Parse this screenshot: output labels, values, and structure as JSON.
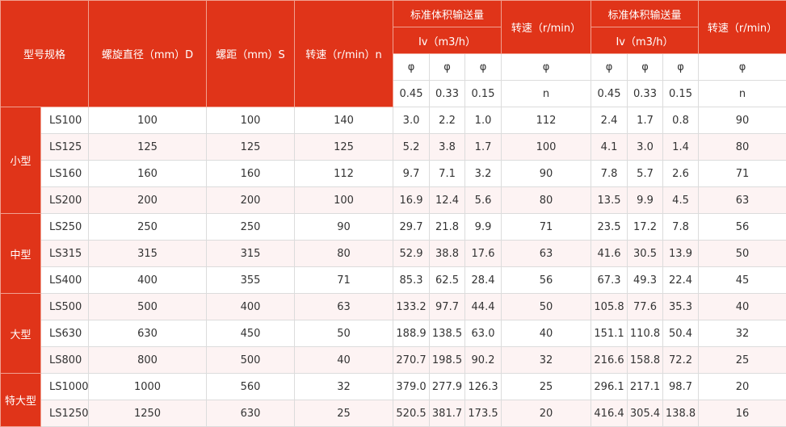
{
  "colors": {
    "header_bg": "#e03419",
    "header_text": "#ffffff",
    "stripe": "#fdf3f3"
  },
  "header": {
    "model": "型号规格",
    "diameter": "螺旋直径（mm）D",
    "pitch": "螺距（mm）S",
    "speed_n": "转速（r/min）n",
    "flow_group_1": "标准体积输送量",
    "flow_unit_1": "Iv（m3/h）",
    "speed_2": "转速（r/min）",
    "flow_group_2": "标准体积输送量",
    "flow_unit_2": "Iv（m3/h）",
    "speed_3": "转速（r/min）",
    "phi": "φ",
    "coef_1": "0.45",
    "coef_2": "0.33",
    "coef_3": "0.15",
    "n": "n"
  },
  "groups": [
    "小型",
    "中型",
    "大型",
    "特大型"
  ],
  "rows": [
    [
      "LS100",
      "100",
      "100",
      "140",
      "3.0",
      "2.2",
      "1.0",
      "112",
      "2.4",
      "1.7",
      "0.8",
      "90"
    ],
    [
      "LS125",
      "125",
      "125",
      "125",
      "5.2",
      "3.8",
      "1.7",
      "100",
      "4.1",
      "3.0",
      "1.4",
      "80"
    ],
    [
      "LS160",
      "160",
      "160",
      "112",
      "9.7",
      "7.1",
      "3.2",
      "90",
      "7.8",
      "5.7",
      "2.6",
      "71"
    ],
    [
      "LS200",
      "200",
      "200",
      "100",
      "16.9",
      "12.4",
      "5.6",
      "80",
      "13.5",
      "9.9",
      "4.5",
      "63"
    ],
    [
      "LS250",
      "250",
      "250",
      "90",
      "29.7",
      "21.8",
      "9.9",
      "71",
      "23.5",
      "17.2",
      "7.8",
      "56"
    ],
    [
      "LS315",
      "315",
      "315",
      "80",
      "52.9",
      "38.8",
      "17.6",
      "63",
      "41.6",
      "30.5",
      "13.9",
      "50"
    ],
    [
      "LS400",
      "400",
      "355",
      "71",
      "85.3",
      "62.5",
      "28.4",
      "56",
      "67.3",
      "49.3",
      "22.4",
      "45"
    ],
    [
      "LS500",
      "500",
      "400",
      "63",
      "133.2",
      "97.7",
      "44.4",
      "50",
      "105.8",
      "77.6",
      "35.3",
      "40"
    ],
    [
      "LS630",
      "630",
      "450",
      "50",
      "188.9",
      "138.5",
      "63.0",
      "40",
      "151.1",
      "110.8",
      "50.4",
      "32"
    ],
    [
      "LS800",
      "800",
      "500",
      "40",
      "270.7",
      "198.5",
      "90.2",
      "32",
      "216.6",
      "158.8",
      "72.2",
      "25"
    ],
    [
      "LS1000",
      "1000",
      "560",
      "32",
      "379.0",
      "277.9",
      "126.3",
      "25",
      "296.1",
      "217.1",
      "98.7",
      "20"
    ],
    [
      "LS1250",
      "1250",
      "630",
      "25",
      "520.5",
      "381.7",
      "173.5",
      "20",
      "416.4",
      "305.4",
      "138.8",
      "16"
    ]
  ]
}
